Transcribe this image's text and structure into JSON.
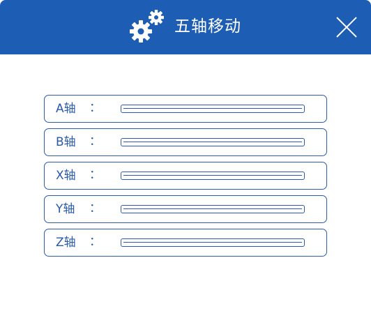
{
  "header": {
    "title": "五轴移动",
    "icon": "gears-icon",
    "close_icon": "close-icon",
    "background_color": "#1d5db3"
  },
  "axes": [
    {
      "label": "A轴",
      "colon": "：",
      "value": ""
    },
    {
      "label": "B轴",
      "colon": "：",
      "value": ""
    },
    {
      "label": "X轴",
      "colon": "：",
      "value": ""
    },
    {
      "label": "Y轴",
      "colon": "：",
      "value": ""
    },
    {
      "label": "Z轴",
      "colon": "：",
      "value": ""
    }
  ],
  "accent_color": "#2a5aa7"
}
